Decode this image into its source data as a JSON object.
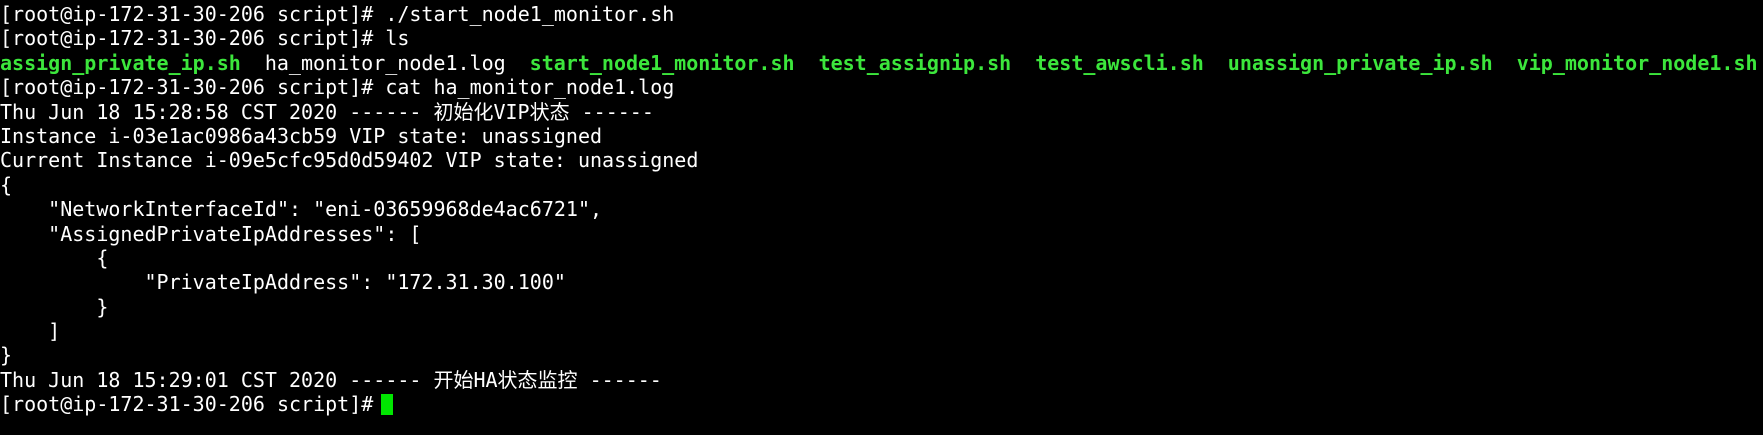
{
  "terminal": {
    "lines": [
      "[root@ip-172-31-30-206 script]# ./start_node1_monitor.sh",
      "[root@ip-172-31-30-206 script]# ls",
      "",
      "[root@ip-172-31-30-206 script]# cat ha_monitor_node1.log",
      "Thu Jun 18 15:28:58 CST 2020 ------ 初始化VIP状态 ------",
      "Instance i-03e1ac0986a43cb59 VIP state: unassigned",
      "Current Instance i-09e5cfc95d0d59402 VIP state: unassigned",
      "{",
      "    \"NetworkInterfaceId\": \"eni-03659968de4ac6721\",",
      "    \"AssignedPrivateIpAddresses\": [",
      "        {",
      "            \"PrivateIpAddress\": \"172.31.30.100\"",
      "        }",
      "    ]",
      "}",
      "Thu Jun 18 15:29:01 CST 2020 ------ 开始HA状态监控 ------",
      "[root@ip-172-31-30-206 script]#"
    ],
    "ls_output": [
      "assign_private_ip.sh",
      "ha_monitor_node1.log",
      "start_node1_monitor.sh",
      "test_assignip.sh",
      "test_awscli.sh",
      "unassign_private_ip.sh",
      "vip_monitor_node1.sh"
    ]
  },
  "colors": {
    "background": "#000000",
    "text": "#ffffff",
    "executable": "#3ce63c",
    "cursor": "#00e600"
  },
  "icons": {
    "cursor": "block-cursor"
  }
}
